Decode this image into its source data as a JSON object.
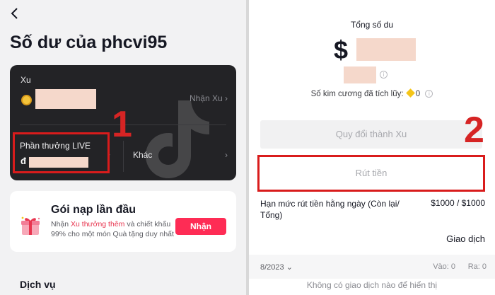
{
  "left": {
    "title": "Số dư của phcvi95",
    "balance_card": {
      "xu_label": "Xu",
      "nhan_xu": "Nhận Xu",
      "live_label": "Phần thưởng LIVE",
      "live_currency": "đ",
      "khac_label": "Khác",
      "chevron": "›"
    },
    "annotation_1": "1",
    "promo": {
      "title": "Gói nạp lần đầu",
      "desc_prefix": "Nhận ",
      "desc_highlight": "Xu thưởng thêm",
      "desc_suffix": " và chiết khấu 99% cho một món Quà tặng duy nhất",
      "button": "Nhận"
    },
    "services_heading": "Dịch vụ"
  },
  "right": {
    "total_label": "Tổng số du",
    "currency_symbol": "$",
    "diamond_text": "Số kim cương đã tích lũy:",
    "diamond_count": "0",
    "convert_button": "Quy đổi thành Xu",
    "withdraw_button": "Rút tiền",
    "annotation_2": "2",
    "limit_label": "Hạn mức rút tiền hằng ngày (Còn lại/ Tổng)",
    "limit_value": "$1000 / $1000",
    "transactions_label": "Giao dịch",
    "month": "8/2023",
    "month_chevron": "⌄",
    "in_label": "Vào: 0",
    "out_label": "Ra: 0",
    "empty_text": "Không có giao dịch nào để hiển thị"
  },
  "colors": {
    "accent": "#fe2c55",
    "annotation_red": "#d91c1c",
    "card_bg": "#232326",
    "redaction": "#f5d8cb"
  }
}
